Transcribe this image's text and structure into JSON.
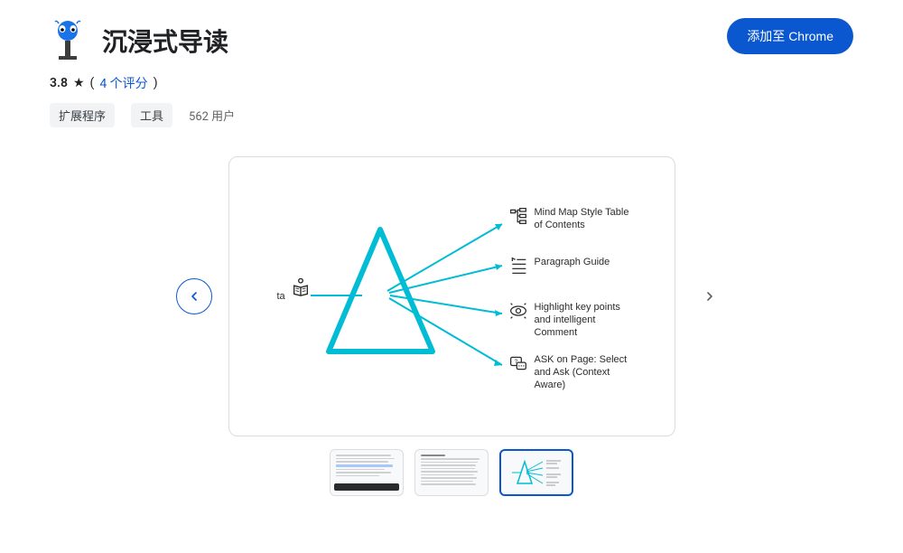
{
  "header": {
    "title": "沉浸式导读",
    "add_button": "添加至 Chrome"
  },
  "meta": {
    "rating": "3.8",
    "reviews_link": "4 个评分"
  },
  "tags": {
    "extension": "扩展程序",
    "tool": "工具",
    "users": "562 用户"
  },
  "slide": {
    "input_label": "ta",
    "features": [
      {
        "text": "Mind Map Style Table of Contents"
      },
      {
        "text": "Paragraph Guide"
      },
      {
        "text": "Highlight key points and intelligent Comment"
      },
      {
        "text": "ASK on Page: Select and Ask (Context Aware)"
      }
    ]
  }
}
